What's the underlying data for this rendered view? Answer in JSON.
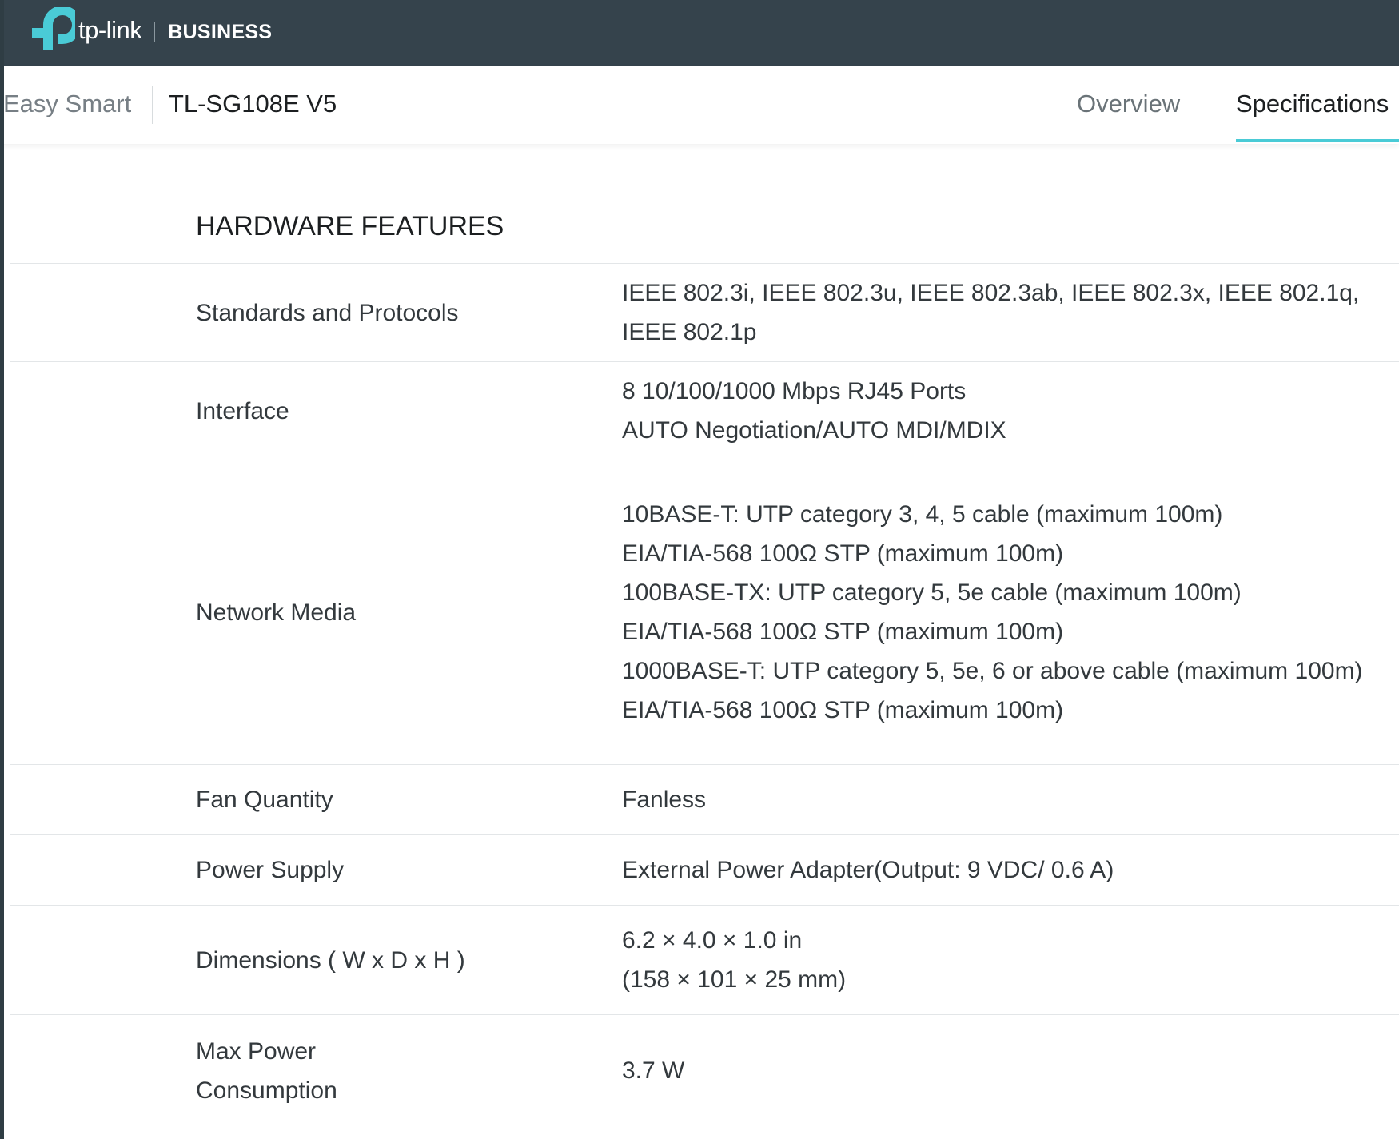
{
  "header": {
    "brand": "tp-link",
    "division": "BUSINESS"
  },
  "subnav": {
    "series": "Easy Smart",
    "model": "TL-SG108E V5",
    "tabs": [
      {
        "label": "Overview",
        "active": false
      },
      {
        "label": "Specifications",
        "active": true
      }
    ]
  },
  "colors": {
    "topbar": "#35434c",
    "accent": "#4acbd6",
    "text": "#33393d"
  },
  "section": {
    "title": "HARDWARE FEATURES",
    "rows": [
      {
        "label": "Standards and Protocols",
        "lines": [
          "IEEE 802.3i, IEEE 802.3u, IEEE 802.3ab, IEEE 802.3x, IEEE 802.1q, IEEE 802.1p"
        ]
      },
      {
        "label": "Interface",
        "lines": [
          "8 10/100/1000 Mbps RJ45 Ports",
          "AUTO Negotiation/AUTO MDI/MDIX"
        ]
      },
      {
        "label": "Network Media",
        "lines": [
          "10BASE-T: UTP category 3, 4, 5 cable (maximum 100m)",
          "EIA/TIA-568 100Ω STP (maximum 100m)",
          "100BASE-TX: UTP category 5, 5e cable (maximum 100m)",
          "EIA/TIA-568 100Ω STP (maximum 100m)",
          "1000BASE-T: UTP category 5, 5e, 6 or above cable (maximum 100m)",
          "EIA/TIA-568 100Ω STP (maximum 100m)"
        ]
      },
      {
        "label": "Fan Quantity",
        "lines": [
          "Fanless"
        ]
      },
      {
        "label": "Power Supply",
        "lines": [
          "External Power Adapter(Output: 9 VDC/ 0.6 A)"
        ]
      },
      {
        "label": "Dimensions ( W x D x H )",
        "lines": [
          "6.2 × 4.0 × 1.0 in",
          "(158 × 101 × 25 mm)"
        ]
      },
      {
        "label": "Max Power Consumption",
        "lines": [
          "3.7 W"
        ]
      }
    ]
  }
}
